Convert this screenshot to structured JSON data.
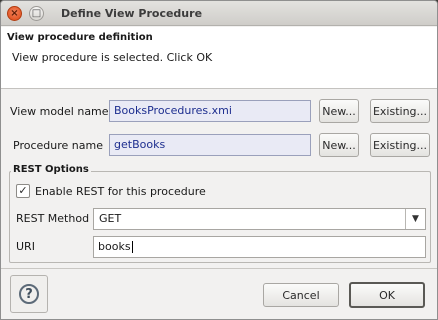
{
  "window": {
    "title": "Define View Procedure",
    "close_glyph": "×",
    "max_glyph": "□"
  },
  "header": {
    "title": "View procedure definition",
    "message": "View procedure is selected. Click OK"
  },
  "view_model": {
    "label": "View model name",
    "value": "BooksProcedures.xmi",
    "new_label": "New...",
    "existing_label": "Existing..."
  },
  "procedure": {
    "label": "Procedure name",
    "value": "getBooks",
    "new_label": "New...",
    "existing_label": "Existing..."
  },
  "rest_options": {
    "title": "REST Options",
    "enable_label": "Enable REST for this procedure",
    "enable_checked": true,
    "check_glyph": "✓",
    "method_label": "REST Method",
    "method_value": "GET",
    "dropdown_glyph": "▼",
    "uri_label": "URI",
    "uri_value": "books"
  },
  "footer": {
    "help_glyph": "?",
    "cancel_label": "Cancel",
    "ok_label": "OK"
  },
  "icons": {
    "close": "close-icon",
    "maximize": "maximize-icon",
    "help": "help-icon",
    "check": "check-icon",
    "dropdown": "chevron-down-icon"
  }
}
